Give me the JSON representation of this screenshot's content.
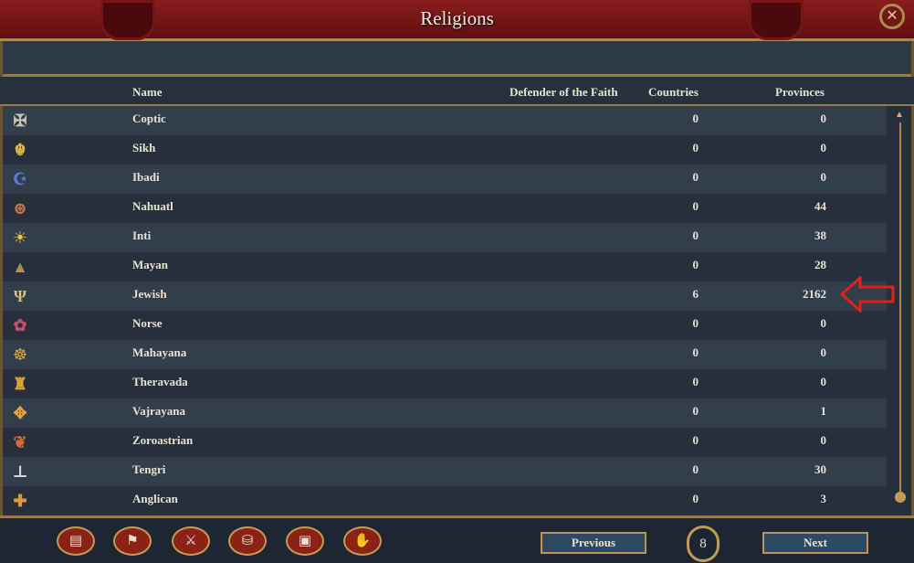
{
  "window": {
    "title": "Religions"
  },
  "header": {
    "name_label": "Name",
    "defender_label": "Defender of the Faith",
    "countries_label": "Countries",
    "provinces_label": "Provinces"
  },
  "religions": [
    {
      "icon": "coptic-cross-icon",
      "glyph": "✠",
      "color": "#c9c2b3",
      "name": "Coptic",
      "countries": "0",
      "provinces": "0"
    },
    {
      "icon": "khanda-icon",
      "glyph": "☬",
      "color": "#e0b64a",
      "name": "Sikh",
      "countries": "0",
      "provinces": "0"
    },
    {
      "icon": "crescent-icon",
      "glyph": "☪",
      "color": "#5b7fc9",
      "name": "Ibadi",
      "countries": "0",
      "provinces": "0"
    },
    {
      "icon": "aztec-sun-stone-icon",
      "glyph": "⊛",
      "color": "#c47a4e",
      "name": "Nahuatl",
      "countries": "0",
      "provinces": "44"
    },
    {
      "icon": "sun-icon",
      "glyph": "☀",
      "color": "#f1c232",
      "name": "Inti",
      "countries": "0",
      "provinces": "38"
    },
    {
      "icon": "pyramid-icon",
      "glyph": "▲",
      "color": "#b08d5a",
      "name": "Mayan",
      "countries": "0",
      "provinces": "28"
    },
    {
      "icon": "menorah-icon",
      "glyph": "Ψ",
      "color": "#d8c27a",
      "name": "Jewish",
      "countries": "6",
      "provinces": "2162"
    },
    {
      "icon": "norse-icon",
      "glyph": "✿",
      "color": "#c0506a",
      "name": "Norse",
      "countries": "0",
      "provinces": "0"
    },
    {
      "icon": "dharma-wheel-icon",
      "glyph": "☸",
      "color": "#e3a23a",
      "name": "Mahayana",
      "countries": "0",
      "provinces": "0"
    },
    {
      "icon": "buddha-statue-icon",
      "glyph": "♜",
      "color": "#d9a53a",
      "name": "Theravada",
      "countries": "0",
      "provinces": "0"
    },
    {
      "icon": "vajra-icon",
      "glyph": "✥",
      "color": "#e3a23a",
      "name": "Vajrayana",
      "countries": "0",
      "provinces": "1"
    },
    {
      "icon": "faravahar-icon",
      "glyph": "❦",
      "color": "#d36b3a",
      "name": "Zoroastrian",
      "countries": "0",
      "provinces": "0"
    },
    {
      "icon": "tengri-icon",
      "glyph": "⊥",
      "color": "#d6d6d6",
      "name": "Tengri",
      "countries": "0",
      "provinces": "30"
    },
    {
      "icon": "anglican-cross-icon",
      "glyph": "✚",
      "color": "#d89a3a",
      "name": "Anglican",
      "countries": "0",
      "provinces": "3"
    }
  ],
  "footer": {
    "previous_label": "Previous",
    "next_label": "Next",
    "page": "8"
  },
  "tabs": [
    {
      "icon": "scroll-icon",
      "glyph": "▤"
    },
    {
      "icon": "flag-icon",
      "glyph": "⚑"
    },
    {
      "icon": "crossed-swords-icon",
      "glyph": "⚔"
    },
    {
      "icon": "coins-icon",
      "glyph": "⛁"
    },
    {
      "icon": "trade-goods-icon",
      "glyph": "▣"
    },
    {
      "icon": "handshake-icon",
      "glyph": "✋"
    }
  ],
  "colors": {
    "title_bar": "#7a1515",
    "frame_gold": "#b08a4a",
    "annotation_arrow": "#e0201e"
  }
}
